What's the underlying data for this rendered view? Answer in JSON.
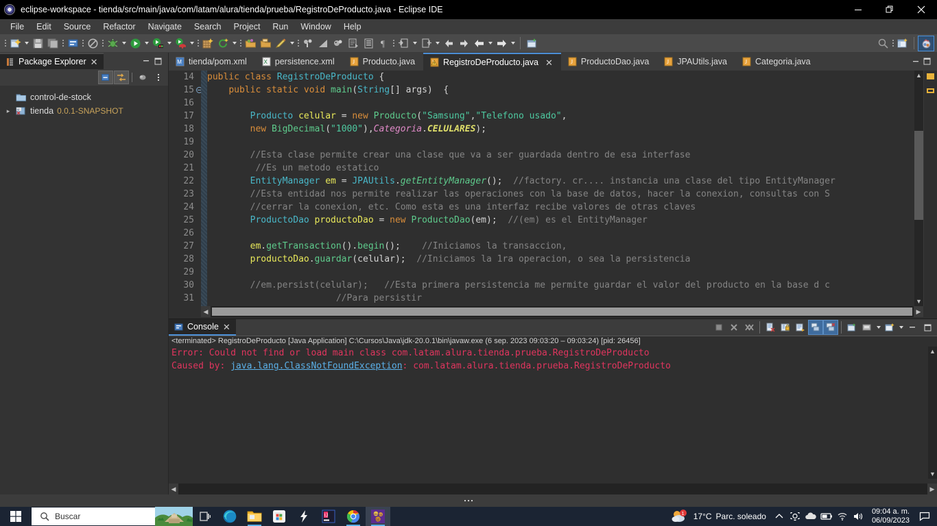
{
  "window": {
    "title": "eclipse-workspace - tienda/src/main/java/com/latam/alura/tienda/prueba/RegistroDeProducto.java - Eclipse IDE",
    "minimize_label": "—",
    "maximize_label": "❐",
    "close_label": "✕"
  },
  "menubar": {
    "items": [
      {
        "label": "File"
      },
      {
        "label": "Edit"
      },
      {
        "label": "Source"
      },
      {
        "label": "Refactor"
      },
      {
        "label": "Navigate"
      },
      {
        "label": "Search"
      },
      {
        "label": "Project"
      },
      {
        "label": "Run"
      },
      {
        "label": "Window"
      },
      {
        "label": "Help"
      }
    ]
  },
  "toolbar": {
    "icons": [
      "new-wizard-icon",
      "save-icon",
      "save-all-icon",
      "print-icon",
      "no-entry-icon",
      "debug-icon",
      "run-icon",
      "run-last-tool-icon",
      "coverage-icon",
      "new-package-icon",
      "refresh-icon",
      "open-type-icon",
      "open-task-icon",
      "external-tools-icon",
      "skip-breakpoints-icon",
      "toggle-breakpoint-icon",
      "search-icon",
      "next-annotation-icon",
      "previous-annotation-icon",
      "back-icon",
      "forward-icon",
      "new-window-icon",
      "quick-access-search-icon",
      "open-perspective-icon",
      "java-perspective-icon"
    ]
  },
  "package_explorer": {
    "tab_label": "Package Explorer",
    "tools": [
      "collapse-all-icon",
      "link-with-editor-icon",
      "view-menu-icon",
      "view-kebab-icon"
    ],
    "tree": [
      {
        "label": "control-de-stock",
        "version": "",
        "expandable": false,
        "icon": "folder-icon"
      },
      {
        "label": "tienda",
        "version": "0.0.1-SNAPSHOT",
        "expandable": true,
        "icon": "maven-project-icon"
      }
    ]
  },
  "editor": {
    "tabs": [
      {
        "label": "tienda/pom.xml",
        "icon": "maven-file-icon",
        "active": false
      },
      {
        "label": "persistence.xml",
        "icon": "xml-file-icon",
        "active": false
      },
      {
        "label": "Producto.java",
        "icon": "java-file-icon",
        "active": false
      },
      {
        "label": "RegistroDeProducto.java",
        "icon": "java-warning-file-icon",
        "active": true
      },
      {
        "label": "ProductoDao.java",
        "icon": "java-file-icon",
        "active": false
      },
      {
        "label": "JPAUtils.java",
        "icon": "java-file-icon",
        "active": false
      },
      {
        "label": "Categoria.java",
        "icon": "java-file-icon",
        "active": false
      }
    ],
    "lines": [
      {
        "num": "14",
        "fold": false,
        "tokens": [
          {
            "t": "public ",
            "c": "kw"
          },
          {
            "t": "class ",
            "c": "kw"
          },
          {
            "t": "RegistroDeProducto ",
            "c": "cls"
          },
          {
            "t": "{",
            "c": "pun"
          }
        ]
      },
      {
        "num": "15",
        "fold": true,
        "tokens": [
          {
            "t": "    ",
            "c": "pun"
          },
          {
            "t": "public static void ",
            "c": "kw"
          },
          {
            "t": "main",
            "c": "mth"
          },
          {
            "t": "(",
            "c": "pun"
          },
          {
            "t": "String",
            "c": "cls"
          },
          {
            "t": "[] args)  {",
            "c": "pun"
          }
        ]
      },
      {
        "num": "16",
        "fold": false,
        "tokens": [
          {
            "t": "",
            "c": "pun"
          }
        ]
      },
      {
        "num": "17",
        "fold": false,
        "tokens": [
          {
            "t": "        ",
            "c": "pun"
          },
          {
            "t": "Producto ",
            "c": "cls"
          },
          {
            "t": "celular ",
            "c": "var"
          },
          {
            "t": "= ",
            "c": "pun"
          },
          {
            "t": "new ",
            "c": "kw"
          },
          {
            "t": "Producto",
            "c": "mth"
          },
          {
            "t": "(",
            "c": "pun"
          },
          {
            "t": "\"Samsung\"",
            "c": "str"
          },
          {
            "t": ",",
            "c": "pun"
          },
          {
            "t": "\"Telefono usado\"",
            "c": "str"
          },
          {
            "t": ",",
            "c": "pun"
          }
        ]
      },
      {
        "num": "18",
        "fold": false,
        "tokens": [
          {
            "t": "        ",
            "c": "pun"
          },
          {
            "t": "new ",
            "c": "kw"
          },
          {
            "t": "BigDecimal",
            "c": "mth"
          },
          {
            "t": "(",
            "c": "pun"
          },
          {
            "t": "\"1000\"",
            "c": "str"
          },
          {
            "t": "),",
            "c": "pun"
          },
          {
            "t": "Categoria",
            "c": "fldi"
          },
          {
            "t": ".",
            "c": "pun"
          },
          {
            "t": "CELULARES",
            "c": "enm"
          },
          {
            "t": ");",
            "c": "pun"
          }
        ]
      },
      {
        "num": "19",
        "fold": false,
        "tokens": [
          {
            "t": "",
            "c": "pun"
          }
        ]
      },
      {
        "num": "20",
        "fold": false,
        "tokens": [
          {
            "t": "        //Esta clase permite crear una clase que va a ser guardada dentro de esa interfase",
            "c": "cmt"
          }
        ]
      },
      {
        "num": "21",
        "fold": false,
        "tokens": [
          {
            "t": "         //Es un metodo estatico",
            "c": "cmt"
          }
        ]
      },
      {
        "num": "22",
        "fold": false,
        "tokens": [
          {
            "t": "        ",
            "c": "pun"
          },
          {
            "t": "EntityManager ",
            "c": "cls"
          },
          {
            "t": "em ",
            "c": "var"
          },
          {
            "t": "= ",
            "c": "pun"
          },
          {
            "t": "JPAUtils",
            "c": "cls"
          },
          {
            "t": ".",
            "c": "pun"
          },
          {
            "t": "getEntityManager",
            "c": "mthi"
          },
          {
            "t": "();",
            "c": "pun"
          },
          {
            "t": "  //factory. cr.... instancia una clase del tipo EntityManager",
            "c": "cmt"
          }
        ]
      },
      {
        "num": "23",
        "fold": false,
        "tokens": [
          {
            "t": "        //Esta entidad nos permite realizar las operaciones con la base de datos, hacer la conexion, consultas con S",
            "c": "cmt"
          }
        ]
      },
      {
        "num": "24",
        "fold": false,
        "tokens": [
          {
            "t": "        //cerrar la conexion, etc. Como esta es una interfaz recibe valores de otras claves",
            "c": "cmt"
          }
        ]
      },
      {
        "num": "25",
        "fold": false,
        "tokens": [
          {
            "t": "        ",
            "c": "pun"
          },
          {
            "t": "ProductoDao ",
            "c": "cls"
          },
          {
            "t": "productoDao ",
            "c": "var"
          },
          {
            "t": "= ",
            "c": "pun"
          },
          {
            "t": "new ",
            "c": "kw"
          },
          {
            "t": "ProductoDao",
            "c": "mth"
          },
          {
            "t": "(em);",
            "c": "pun"
          },
          {
            "t": "  //(em) es el EntityManager",
            "c": "cmt"
          }
        ]
      },
      {
        "num": "26",
        "fold": false,
        "tokens": [
          {
            "t": "",
            "c": "pun"
          }
        ]
      },
      {
        "num": "27",
        "fold": false,
        "tokens": [
          {
            "t": "        ",
            "c": "pun"
          },
          {
            "t": "em",
            "c": "var"
          },
          {
            "t": ".",
            "c": "pun"
          },
          {
            "t": "getTransaction",
            "c": "mth"
          },
          {
            "t": "().",
            "c": "pun"
          },
          {
            "t": "begin",
            "c": "mth"
          },
          {
            "t": "();",
            "c": "pun"
          },
          {
            "t": "    //Iniciamos la transaccion,",
            "c": "cmt"
          }
        ]
      },
      {
        "num": "28",
        "fold": false,
        "tokens": [
          {
            "t": "        ",
            "c": "pun"
          },
          {
            "t": "productoDao",
            "c": "var"
          },
          {
            "t": ".",
            "c": "pun"
          },
          {
            "t": "guardar",
            "c": "mth"
          },
          {
            "t": "(celular);",
            "c": "pun"
          },
          {
            "t": "  //Iniciamos la 1ra operacion, o sea la persistencia",
            "c": "cmt"
          }
        ]
      },
      {
        "num": "29",
        "fold": false,
        "tokens": [
          {
            "t": "",
            "c": "pun"
          }
        ]
      },
      {
        "num": "30",
        "fold": false,
        "tokens": [
          {
            "t": "        //em.persist(celular);   //Esta primera persistencia me permite guardar el valor del producto en la base d c",
            "c": "cmt"
          }
        ]
      },
      {
        "num": "31",
        "fold": false,
        "tokens": [
          {
            "t": "                        //Para persistir",
            "c": "cmt"
          }
        ]
      }
    ]
  },
  "console": {
    "tab_label": "Console",
    "tools": [
      "terminate-icon",
      "remove-launch-icon",
      "remove-all-terminated-icon",
      "clear-console-icon",
      "scroll-lock-icon",
      "word-wrap-icon",
      "show-console-icon",
      "pin-console-icon",
      "display-selected-console-icon",
      "open-console-icon",
      "minimize-icon",
      "maximize-icon"
    ],
    "header": "<terminated> RegistroDeProducto [Java Application] C:\\Cursos\\Java\\jdk-20.0.1\\bin\\javaw.exe  (6 sep. 2023 09:03:20 – 09:03:24) [pid: 26456]",
    "lines": [
      {
        "segments": [
          {
            "t": "Error: Could not find or load main class com.latam.alura.tienda.prueba.RegistroDeProducto",
            "link": false
          }
        ]
      },
      {
        "segments": [
          {
            "t": "Caused by: ",
            "link": false
          },
          {
            "t": "java.lang.ClassNotFoundException",
            "link": true
          },
          {
            "t": ": com.latam.alura.tienda.prueba.RegistroDeProducto",
            "link": false
          }
        ]
      }
    ]
  },
  "taskbar": {
    "start_label": "start-icon",
    "search_placeholder": "Buscar",
    "icons": [
      "task-view-icon",
      "edge-icon",
      "file-explorer-icon",
      "microsoft-store-icon",
      "lightning-icon",
      "intellij-idea-icon",
      "chrome-icon",
      "eclipse-icon"
    ],
    "weather_temp": "17°C",
    "weather_desc": "Parc. soleado",
    "tray_icons": [
      "show-hidden-icons-icon",
      "camera-icon",
      "onedrive-icon",
      "battery-icon",
      "wifi-icon",
      "volume-icon"
    ],
    "time": "09:04 a. m.",
    "date": "06/09/2023",
    "notification_label": "notifications-icon"
  },
  "colors": {
    "accent": "#4c8fd6",
    "error": "#e0355e",
    "link": "#5bb0e8",
    "comment": "#848484"
  }
}
